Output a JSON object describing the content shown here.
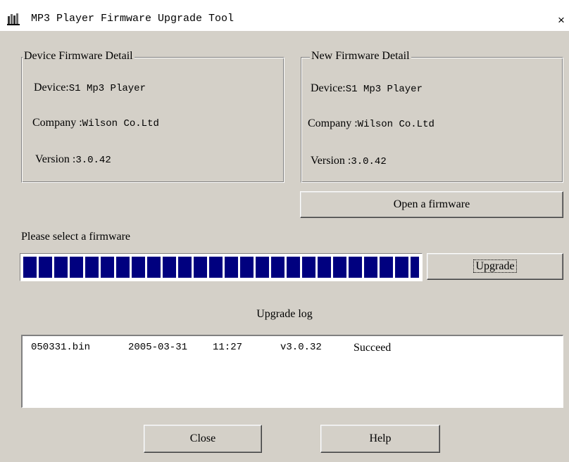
{
  "window": {
    "title": "MP3 Player Firmware Upgrade Tool",
    "close_label": "×"
  },
  "device_group": {
    "title": "Device Firmware Detail",
    "device_label": "Device:",
    "device_value": "S1 Mp3 Player",
    "company_label": "Company :",
    "company_value": "Wilson Co.Ltd",
    "version_label": "Version :",
    "version_value": "3.0.42"
  },
  "new_group": {
    "title": "New Firmware Detail",
    "device_label": "Device:",
    "device_value": "S1 Mp3 Player",
    "company_label": "Company :",
    "company_value": "Wilson Co.Ltd",
    "version_label": "Version :",
    "version_value": "3.0.42"
  },
  "open_button": "Open a firmware",
  "status_text": "Please select a firmware",
  "progress": {
    "fraction": 1.0,
    "color": "#00007f"
  },
  "upgrade_button": "Upgrade",
  "log": {
    "title": "Upgrade log",
    "entries": [
      {
        "file": "050331.bin",
        "date": "2005-03-31",
        "time": "11:27",
        "version": "v3.0.32",
        "result": "Succeed"
      }
    ]
  },
  "buttons": {
    "close": "Close",
    "help": "Help"
  },
  "icons": {
    "app": "mp3-player-icon",
    "close": "close-icon"
  }
}
